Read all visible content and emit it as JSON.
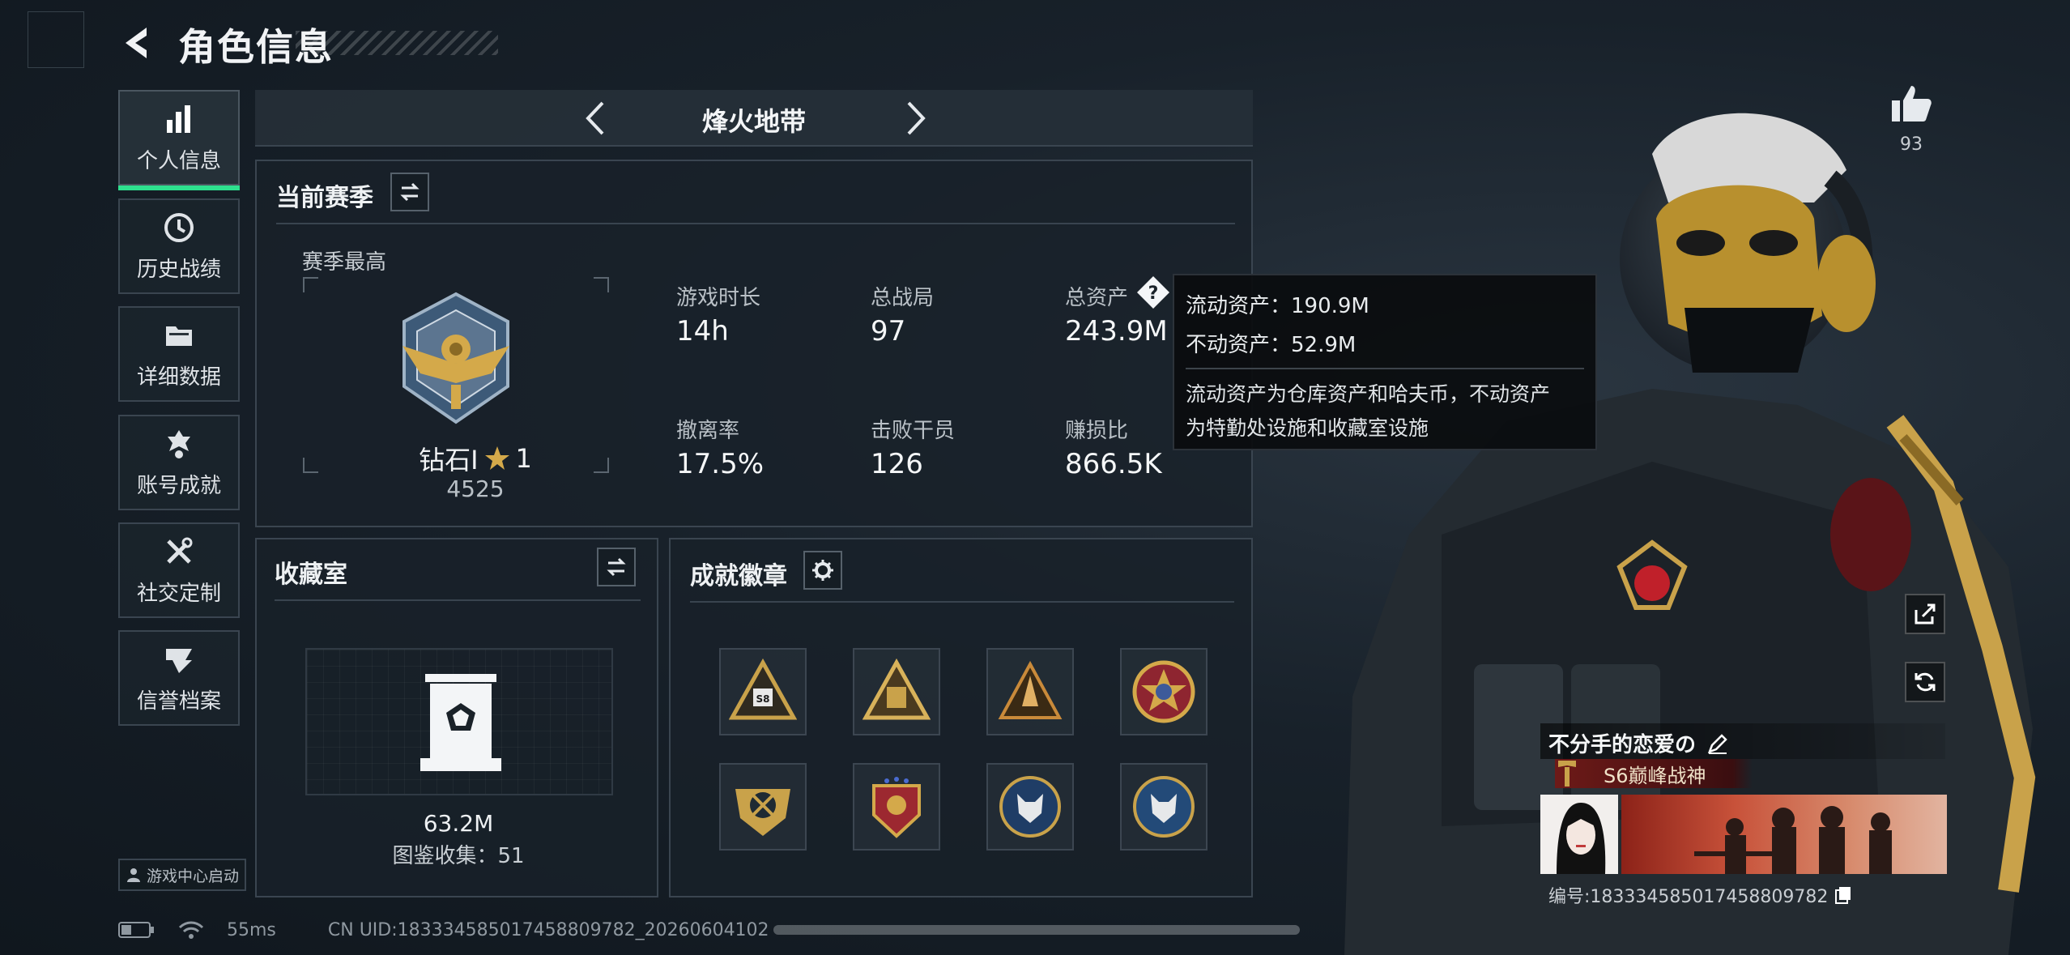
{
  "header": {
    "title": "角色信息"
  },
  "nav": {
    "items": [
      {
        "label": "个人信息",
        "icon": "bar-chart-icon",
        "active": true
      },
      {
        "label": "历史战绩",
        "icon": "clock-icon",
        "active": false
      },
      {
        "label": "详细数据",
        "icon": "folder-icon",
        "active": false
      },
      {
        "label": "账号成就",
        "icon": "medal-icon",
        "active": false
      },
      {
        "label": "社交定制",
        "icon": "tools-icon",
        "active": false
      },
      {
        "label": "信誉档案",
        "icon": "shield-icon",
        "active": false
      }
    ],
    "game_center": "游戏中心启动"
  },
  "mode": {
    "title": "烽火地带"
  },
  "season": {
    "title": "当前赛季",
    "best_label": "赛季最高",
    "rank_name": "钻石Ⅰ",
    "rank_stars": "1",
    "rank_score": "4525",
    "stats": [
      {
        "label": "游戏时长",
        "value": "14h"
      },
      {
        "label": "总战局",
        "value": "97"
      },
      {
        "label": "总资产",
        "value": "243.9M"
      },
      {
        "label": "撤离率",
        "value": "17.5%"
      },
      {
        "label": "击败干员",
        "value": "126"
      },
      {
        "label": "赚损比",
        "value": "866.5K"
      }
    ]
  },
  "tooltip": {
    "liquid": "流动资产：190.9M",
    "fixed": "不动资产：52.9M",
    "desc_line1": "流动资产为仓库资产和哈夫币，不动资产",
    "desc_line2": "为特勤处设施和收藏室设施"
  },
  "collection": {
    "title": "收藏室",
    "value": "63.2M",
    "catalog": "图鉴收集：51"
  },
  "badges": {
    "title": "成就徽章",
    "first_badge_text": "S8"
  },
  "player": {
    "like_count": "93",
    "name": "不分手的恋爱の",
    "rank_title": "S6巅峰战神",
    "id": "编号:18333458501745880978​2"
  },
  "status": {
    "ping": "55ms",
    "uid": "CN UID:18333458501745880978​2_20260604102"
  },
  "colors": {
    "accent": "#2ee08e",
    "panel_border": "#3a4550",
    "tooltip_bg": "#0a0c0e"
  }
}
